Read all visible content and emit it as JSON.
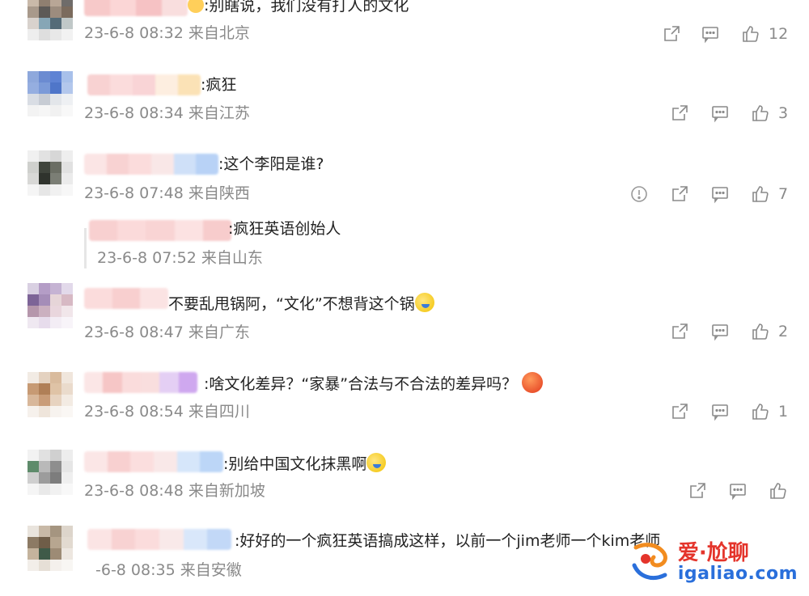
{
  "comments": [
    {
      "text": ":别瞎说，我们没有打人的文化",
      "meta": "23-6-8 08:32 来自北京",
      "likes": "12"
    },
    {
      "text": ":疯狂",
      "meta": "23-6-8 08:34 来自江苏",
      "likes": "3"
    },
    {
      "text": ":这个李阳是谁?",
      "meta": "23-6-8 07:48 来自陕西",
      "likes": "7"
    },
    {
      "text": ":疯狂英语创始人",
      "meta": "23-6-8 07:52 来自山东",
      "likes": ""
    },
    {
      "text": "不要乱甩锅阿，“文化”不想背这个锅",
      "meta": "23-6-8 08:47 来自广东",
      "likes": "2"
    },
    {
      "text": ":啥文化差异？“家暴”合法与不合法的差异吗？",
      "meta": "23-6-8 08:54 来自四川",
      "likes": "1"
    },
    {
      "text": ":别给中国文化抹黑啊",
      "meta": "23-6-8 08:48 来自新加坡",
      "likes": ""
    },
    {
      "text": ":好好的一个疯狂英语搞成这样，以前一个jim老师一个kim老师",
      "meta": "-6-8 08:35 来自安徽",
      "likes": ""
    }
  ],
  "watermark": {
    "top": "爱·尬聊",
    "bottom": "igaliao.com"
  },
  "icons": {
    "share": "share-icon",
    "comment": "comment-icon",
    "like": "thumbs-up-icon",
    "report": "report-icon"
  }
}
